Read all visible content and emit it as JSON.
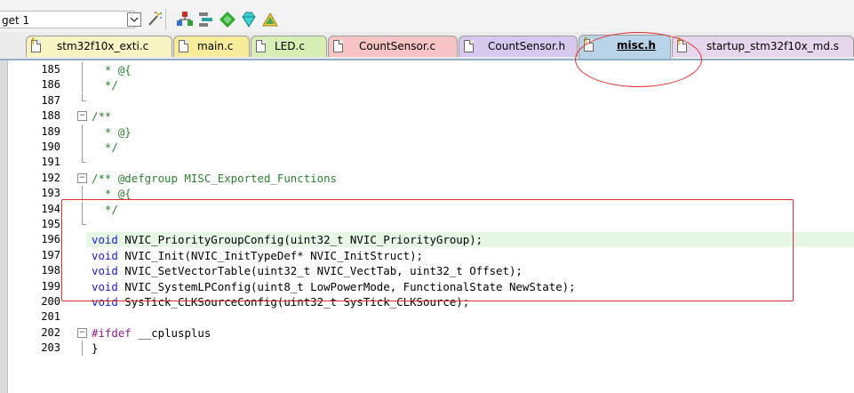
{
  "toolbar": {
    "target_value": "get 1",
    "dropdown_icon": "chevron-down-icon"
  },
  "tabs": [
    {
      "label": "stm32f10x_exti.c",
      "color": "#f7f3c3",
      "icon": "key-file-icon",
      "active": false
    },
    {
      "label": "main.c",
      "color": "#f6ec9c",
      "icon": "file-icon",
      "active": false
    },
    {
      "label": "LED.c",
      "color": "#d7efb5",
      "icon": "file-icon",
      "active": false
    },
    {
      "label": "CountSensor.c",
      "color": "#f6c4c4",
      "icon": "file-icon",
      "active": false
    },
    {
      "label": "CountSensor.h",
      "color": "#d7c8ee",
      "icon": "file-icon",
      "active": false
    },
    {
      "label": "misc.h",
      "color": "#b9d4e8",
      "icon": "key-file-icon",
      "active": true
    },
    {
      "label": "startup_stm32f10x_md.s",
      "color": "#e6d6ec",
      "icon": "key-file-icon",
      "active": false
    }
  ],
  "editor": {
    "lines": [
      {
        "num": "185",
        "text": "  * @{",
        "kind": "comment"
      },
      {
        "num": "186",
        "text": "  */",
        "kind": "comment"
      },
      {
        "num": "187",
        "text": "",
        "kind": "plain"
      },
      {
        "num": "188",
        "text": "/**",
        "kind": "comment"
      },
      {
        "num": "189",
        "text": "  * @}",
        "kind": "comment"
      },
      {
        "num": "190",
        "text": "  */",
        "kind": "comment"
      },
      {
        "num": "191",
        "text": "",
        "kind": "plain"
      },
      {
        "num": "192",
        "text": "/** @defgroup MISC_Exported_Functions",
        "kind": "comment"
      },
      {
        "num": "193",
        "text": "  * @{",
        "kind": "comment"
      },
      {
        "num": "194",
        "text": "  */",
        "kind": "comment"
      },
      {
        "num": "195",
        "text": "",
        "kind": "plain"
      },
      {
        "num": "196",
        "kw": "void",
        "text": " NVIC_PriorityGroupConfig(uint32_t NVIC_PriorityGroup);",
        "kind": "decl"
      },
      {
        "num": "197",
        "kw": "void",
        "text": " NVIC_Init(NVIC_InitTypeDef* NVIC_InitStruct);",
        "kind": "decl"
      },
      {
        "num": "198",
        "kw": "void",
        "text": " NVIC_SetVectorTable(uint32_t NVIC_VectTab, uint32_t Offset);",
        "kind": "decl"
      },
      {
        "num": "199",
        "kw": "void",
        "text": " NVIC_SystemLPConfig(uint8_t LowPowerMode, FunctionalState NewState);",
        "kind": "decl"
      },
      {
        "num": "200",
        "kw": "void",
        "text": " SysTick_CLKSourceConfig(uint32_t SysTick_CLKSource);",
        "kind": "decl"
      },
      {
        "num": "201",
        "text": "",
        "kind": "plain"
      },
      {
        "num": "202",
        "kw": "#ifdef",
        "text": " __cplusplus",
        "kind": "pp"
      },
      {
        "num": "203",
        "text": "}",
        "kind": "plain"
      }
    ]
  }
}
